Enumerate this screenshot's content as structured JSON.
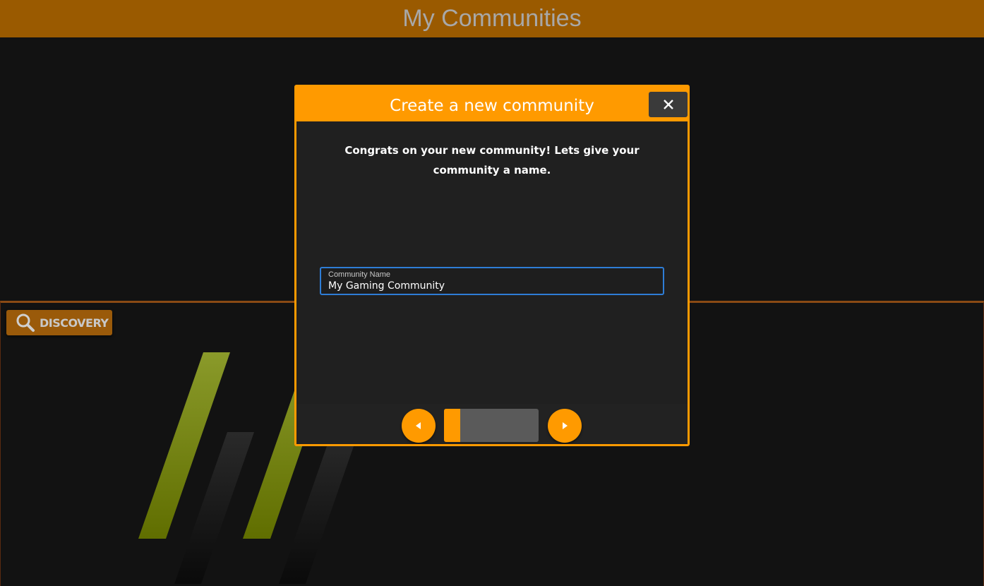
{
  "header": {
    "title": "My Communities"
  },
  "discovery": {
    "label": "DISCOVERY",
    "icon": "search-icon"
  },
  "modal": {
    "title": "Create a new community",
    "close_icon": "close-icon",
    "message": "Congrats on your new community! Lets give your community a name.",
    "field": {
      "label": "Community Name",
      "value": "My Gaming Community"
    },
    "footer": {
      "prev_icon": "caret-left-icon",
      "next_icon": "caret-right-icon",
      "progress_fraction": 0.17
    }
  },
  "colors": {
    "header_bg": "#9a5a00",
    "accent": "#ff9a00",
    "field_border": "#2e7dd6",
    "logo_green": "#7a8a1a"
  }
}
